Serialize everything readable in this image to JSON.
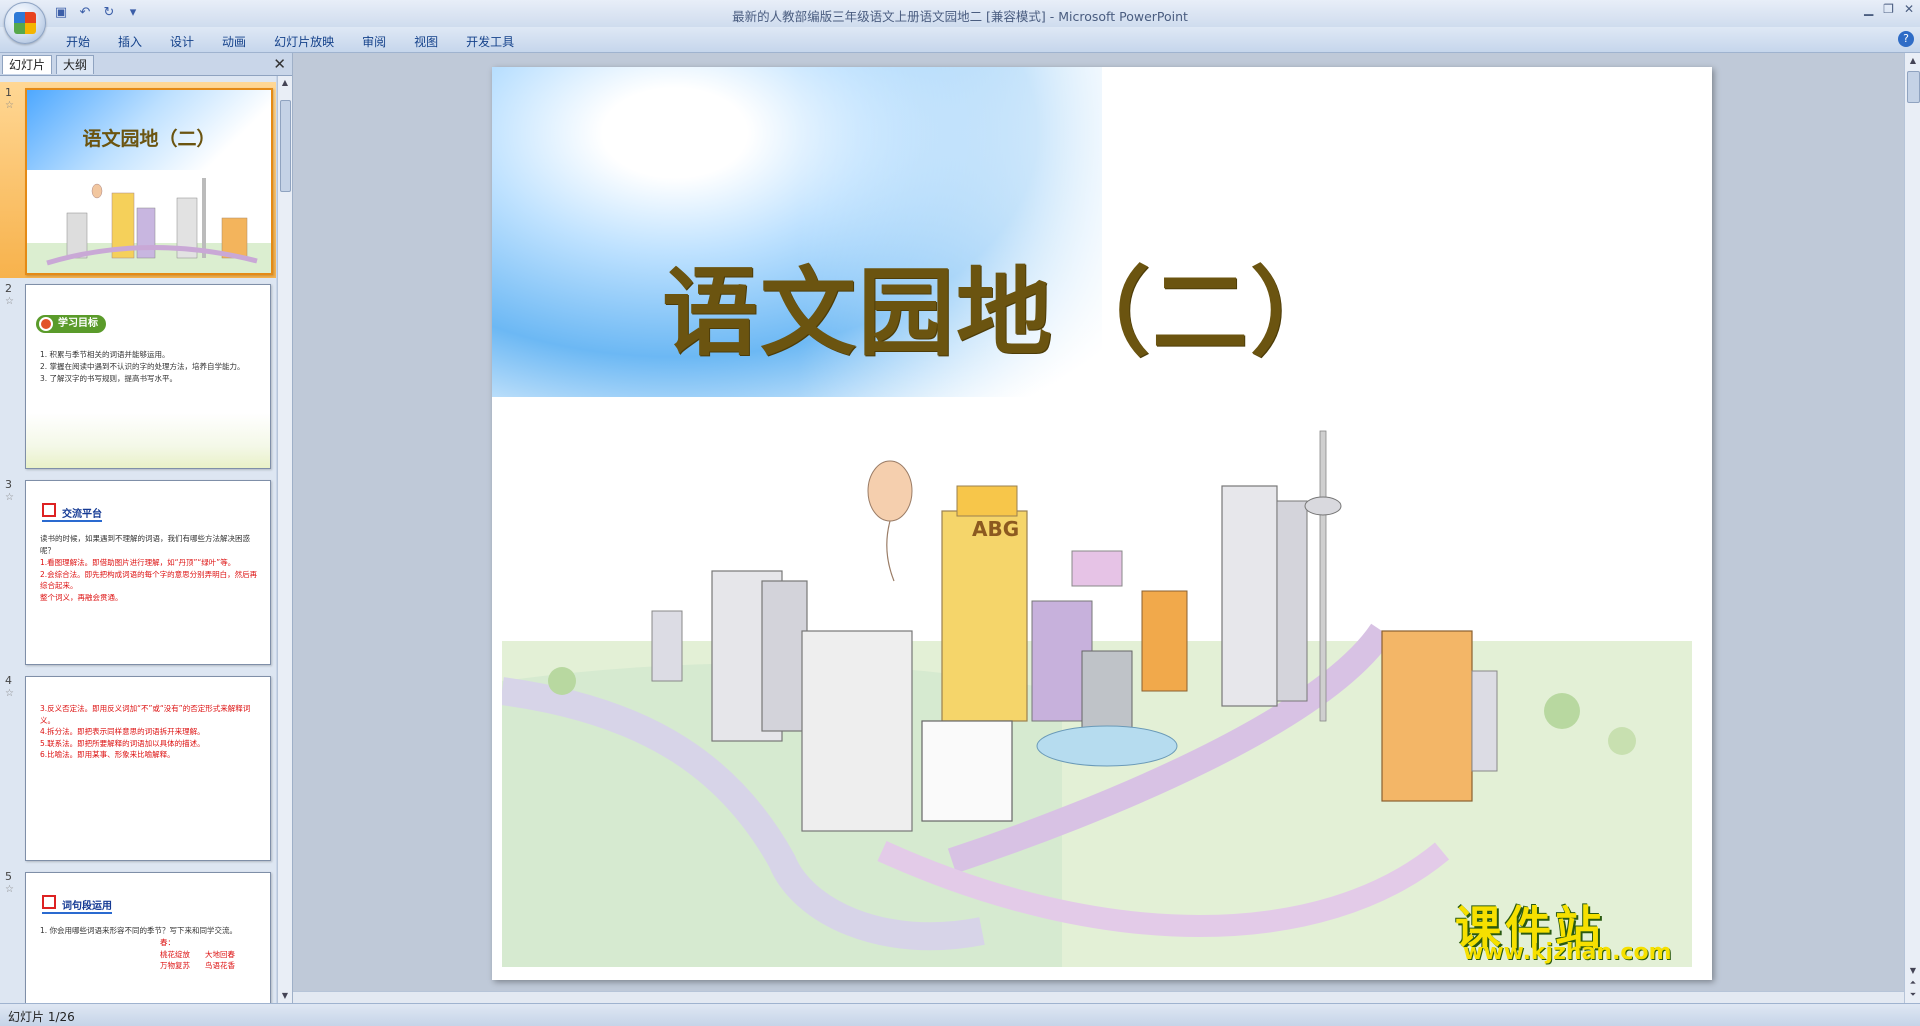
{
  "window": {
    "title": "最新的人教部编版三年级语文上册语文园地二 [兼容模式] - Microsoft PowerPoint"
  },
  "quick_access": {
    "icons": [
      "save-icon",
      "undo-icon",
      "redo-icon",
      "customize-icon"
    ]
  },
  "ribbon": {
    "tabs": [
      "开始",
      "插入",
      "设计",
      "动画",
      "幻灯片放映",
      "审阅",
      "视图",
      "开发工具"
    ]
  },
  "left_pane": {
    "tabs": [
      "幻灯片",
      "大纲"
    ],
    "active_tab": "幻灯片",
    "slides": [
      {
        "num": "1",
        "title": "语文园地（二）",
        "selected": true
      },
      {
        "num": "2",
        "badge": "学习目标",
        "lines": [
          "1. 积累与季节相关的词语并能够运用。",
          "2. 掌握在阅读中遇到不认识的字的处理方法，培养自学能力。",
          "3. 了解汉字的书写规则，提高书写水平。"
        ]
      },
      {
        "num": "3",
        "heading": "交流平台",
        "intro": "读书的时候，如果遇到不理解的词语，我们有哪些方法解决困惑呢？",
        "lines": [
          "1.看图理解法。即借助图片进行理解，如“丹顶”“绿叶”等。",
          "2.会综合法。即先把构成词语的每个字的意思分别弄明白，然后再综合起来。",
          "整个词义，再融会贯通。"
        ]
      },
      {
        "num": "4",
        "lines": [
          "3.反义否定法。即用反义词加“不”或“没有”的否定形式来解释词义。",
          "4.拆分法。即把表示同样意思的词语拆开来理解。",
          "5.联系法。即把所要解释的词语加以具体的描述。",
          "6.比喻法。即用某事、形象来比喻解释。"
        ]
      },
      {
        "num": "5",
        "heading": "词句段运用",
        "intro": "1. 你会用哪些词语来形容不同的季节？写下来和同学交流。",
        "lines": [
          "春：",
          "桃花绽放　　大地回春",
          "万物复苏　　鸟语花香"
        ]
      }
    ]
  },
  "slide": {
    "title": "语文园地（二）"
  },
  "watermark": {
    "main": "课件站",
    "sub": "www.kjzhan.com"
  },
  "status": {
    "slide_counter": "幻灯片 1/26"
  }
}
